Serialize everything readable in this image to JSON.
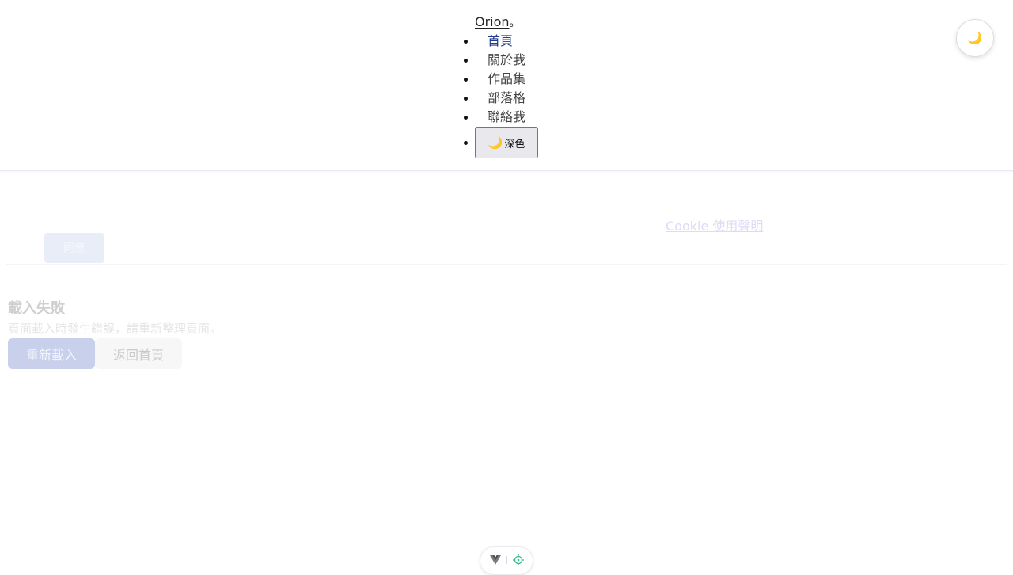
{
  "header": {
    "brand": "Orion",
    "brand_suffix": "。",
    "nav": [
      {
        "label": "首頁",
        "active": true
      },
      {
        "label": "關於我",
        "active": false
      },
      {
        "label": "作品集",
        "active": false
      },
      {
        "label": "部落格",
        "active": false
      },
      {
        "label": "聯絡我",
        "active": false
      }
    ],
    "theme_toggle": {
      "icon": "moon-icon",
      "glyph": "🌙",
      "label": "深色"
    },
    "theme_fab": {
      "icon": "moon-icon",
      "glyph": "🌙"
    }
  },
  "cookie_notice": {
    "link_text": "Cookie 使用聲明",
    "agree_label": "同意"
  },
  "error": {
    "title": "載入失敗",
    "message": "頁面載入時發生錯誤，請重新整理頁面。",
    "reload_label": "重新載入",
    "home_label": "返回首頁"
  },
  "dev_toolbar": {
    "icons": [
      "vue-logo-icon",
      "crosshair-icon"
    ]
  },
  "colors": {
    "active_nav": "#1f3a8f",
    "moon": "#f2b705",
    "crosshair": "#2fb88a"
  }
}
